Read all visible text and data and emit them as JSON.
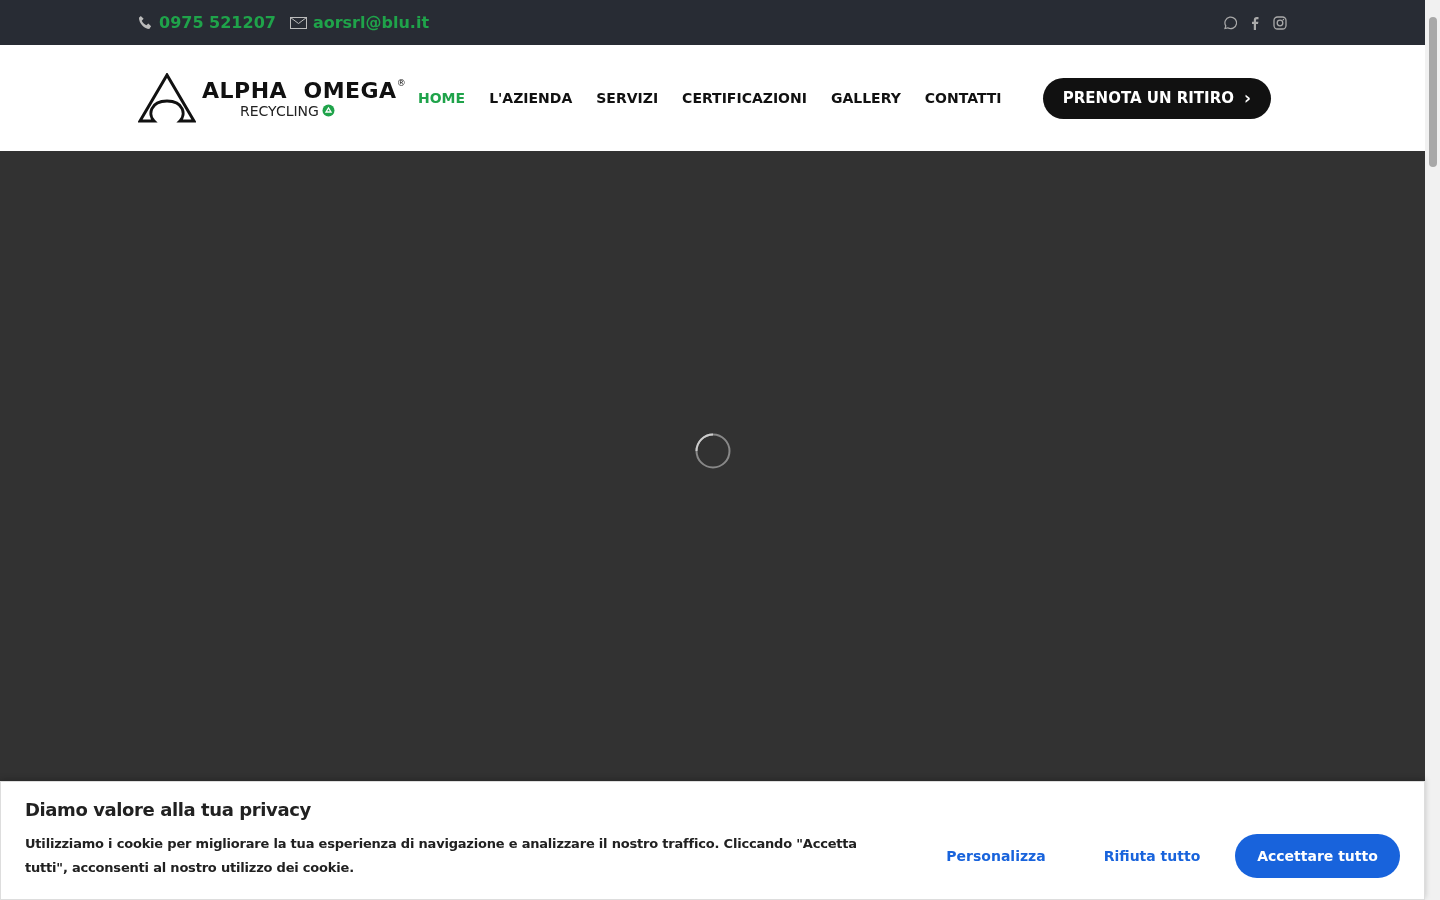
{
  "top_bar": {
    "phone": "0975 521207",
    "email": "aorsrl@blu.it"
  },
  "logo": {
    "name": "ALPHA  OMEGA",
    "registered": "®",
    "tagline": "RECYCLING"
  },
  "nav": [
    {
      "label": "HOME",
      "selected": true
    },
    {
      "label": "L'AZIENDA",
      "selected": false
    },
    {
      "label": "SERVIZI",
      "selected": false
    },
    {
      "label": "CERTIFICAZIONI",
      "selected": false
    },
    {
      "label": "GALLERY",
      "selected": false
    },
    {
      "label": "CONTATTI",
      "selected": false
    }
  ],
  "cta": {
    "label": "PRENOTA UN RITIRO",
    "icon": "›"
  },
  "cookie_banner": {
    "title": "Diamo valore alla tua privacy",
    "text": "Utilizziamo i cookie per migliorare la tua esperienza di navigazione e analizzare il nostro traffico. Cliccando \"Accetta tutti\", acconsenti al nostro utilizzo dei cookie.",
    "buttons": [
      {
        "label": "Personalizza",
        "kind": "link"
      },
      {
        "label": "Rifiuta tutto",
        "kind": "link"
      },
      {
        "label": "Accettare tutto",
        "kind": "primary"
      }
    ]
  }
}
